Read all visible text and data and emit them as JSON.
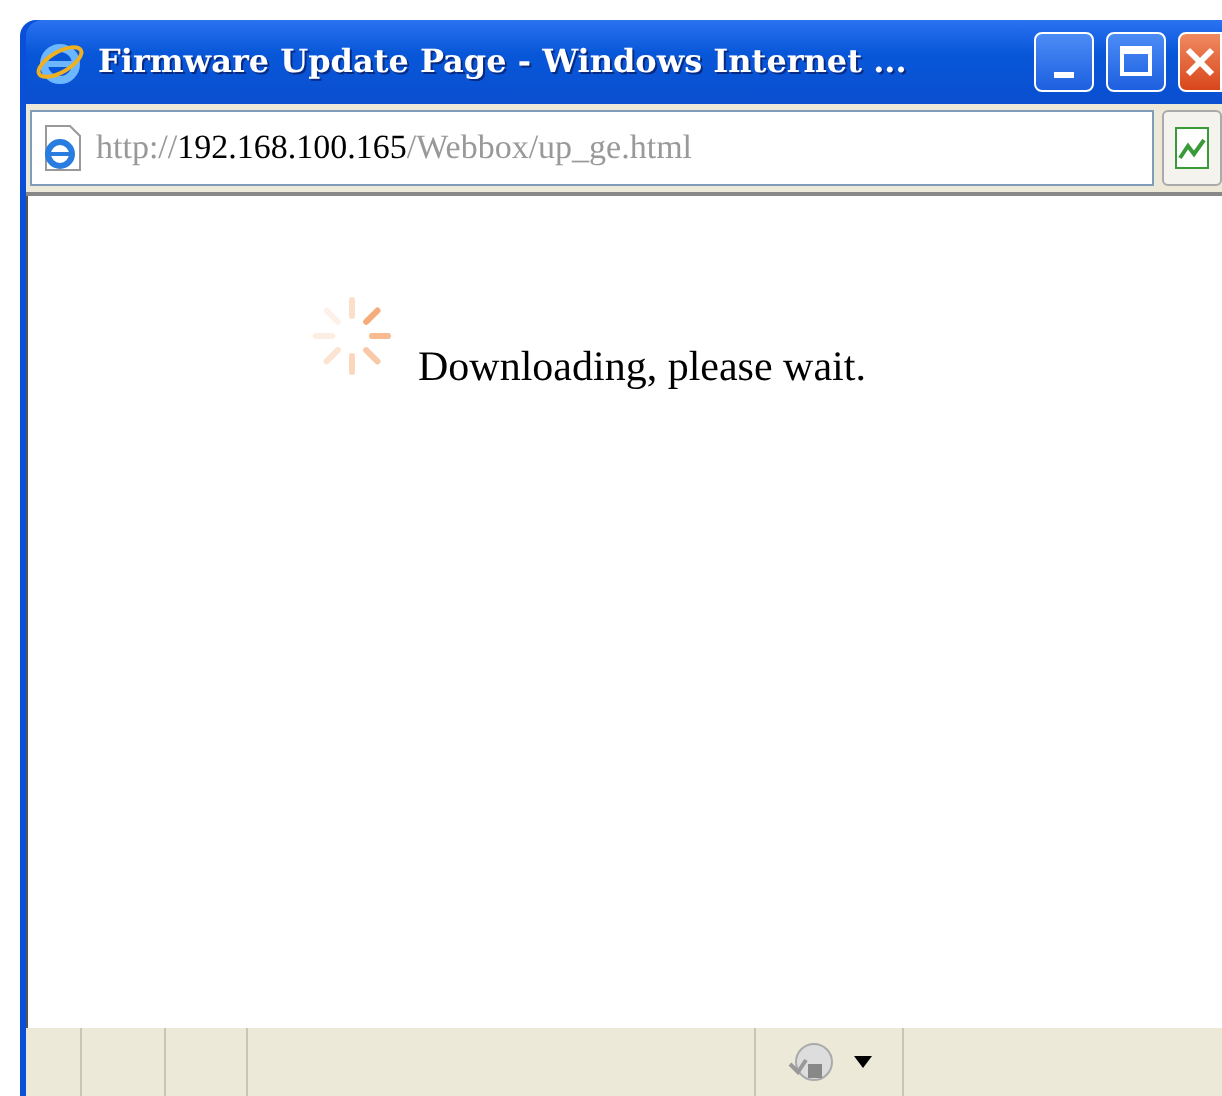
{
  "window": {
    "title": "Firmware Update Page - Windows Internet ..."
  },
  "address_bar": {
    "scheme": "http://",
    "host": "192.168.100.165",
    "path": "/Webbox/up_ge.html"
  },
  "page": {
    "loading": true,
    "message": "Downloading, please wait."
  }
}
